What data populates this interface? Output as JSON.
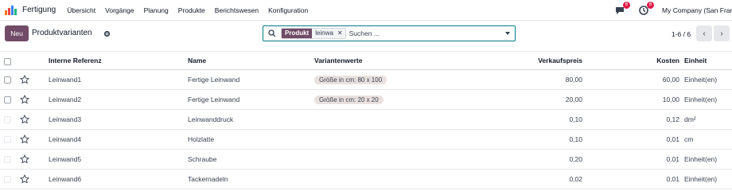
{
  "navbar": {
    "app_name": "Fertigung",
    "menu": [
      "Übersicht",
      "Vorgänge",
      "Planung",
      "Produkte",
      "Berichtswesen",
      "Konfiguration"
    ],
    "chat_badge": "6",
    "activity_badge": "6",
    "company": "My Company (San Francisco)"
  },
  "control": {
    "new_button": "Neu",
    "title": "Produktvarianten",
    "search": {
      "facet_label": "Produkt",
      "facet_value": "leinwa",
      "placeholder": "Suchen ..."
    },
    "pager": "1-6 / 6"
  },
  "table": {
    "headers": {
      "ref": "Interne Referenz",
      "name": "Name",
      "variants": "Variantenwerte",
      "price": "Verkaufspreis",
      "cost": "Kosten",
      "unit": "Einheit"
    },
    "rows": [
      {
        "ref": "Leinwand1",
        "name": "Fertige Leinwand",
        "variant": "Größe in cm: 80 x 100",
        "price": "80,00",
        "cost": "60,00",
        "unit": "Einheit(en)"
      },
      {
        "ref": "Leinwand2",
        "name": "Fertige Leinwand",
        "variant": "Größe in cm: 20 x 20",
        "price": "20,00",
        "cost": "10,00",
        "unit": "Einheit(en)"
      },
      {
        "ref": "Leinwand3",
        "name": "Leinwanddruck",
        "variant": "",
        "price": "0,10",
        "cost": "0,12",
        "unit": "dm²"
      },
      {
        "ref": "Leinwand4",
        "name": "Holzlatte",
        "variant": "",
        "price": "0,10",
        "cost": "0,01",
        "unit": "cm"
      },
      {
        "ref": "Leinwand5",
        "name": "Schraube",
        "variant": "",
        "price": "0,20",
        "cost": "0,01",
        "unit": "Einheit(en)"
      },
      {
        "ref": "Leinwand6",
        "name": "Tackernadeln",
        "variant": "",
        "price": "0,02",
        "cost": "0,01",
        "unit": "Einheit(en)"
      }
    ]
  },
  "colors": {
    "brand": "#714b67",
    "search_border": "#017e84",
    "badge": "#e11d48"
  },
  "icons": {
    "logo": "app-logo-icon",
    "chat": "chat-icon",
    "activity": "clock-icon",
    "gear": "gear-icon",
    "search": "search-icon",
    "star": "star-icon",
    "prev": "chevron-left-icon",
    "next": "chevron-right-icon"
  }
}
